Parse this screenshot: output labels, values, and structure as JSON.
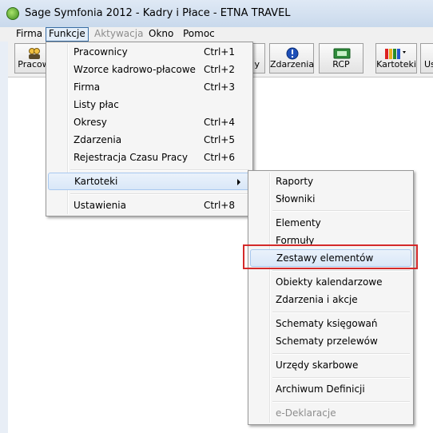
{
  "window": {
    "title": "Sage Symfonia 2012 - Kadry i Płace - ETNA TRAVEL"
  },
  "menubar": {
    "items": [
      {
        "label": "Firma",
        "state": "normal"
      },
      {
        "label": "Funkcje",
        "state": "active"
      },
      {
        "label": "Aktywacja",
        "state": "disabled"
      },
      {
        "label": "Okno",
        "state": "normal"
      },
      {
        "label": "Pomoc",
        "state": "normal"
      }
    ]
  },
  "toolbar": {
    "buttons": [
      {
        "label": "Pracow",
        "icon": "users-icon"
      },
      {
        "label": "y",
        "icon": ""
      },
      {
        "label": "Zdarzenia",
        "icon": "info-icon"
      },
      {
        "label": "RCP",
        "icon": "rcp-icon"
      },
      {
        "label": "Kartoteki",
        "icon": "kartoteki-icon"
      },
      {
        "label": "Us",
        "icon": ""
      }
    ]
  },
  "funkcje_menu": {
    "items": [
      {
        "label": "Pracownicy",
        "shortcut": "Ctrl+1"
      },
      {
        "label": "Wzorce kadrowo-płacowe",
        "shortcut": "Ctrl+2"
      },
      {
        "label": "Firma",
        "shortcut": "Ctrl+3"
      },
      {
        "label": "Listy płac",
        "shortcut": ""
      },
      {
        "label": "Okresy",
        "shortcut": "Ctrl+4"
      },
      {
        "label": "Zdarzenia",
        "shortcut": "Ctrl+5"
      },
      {
        "label": "Rejestracja Czasu Pracy",
        "shortcut": "Ctrl+6"
      },
      {
        "label": "Kartoteki",
        "shortcut": "",
        "submenu": true
      },
      {
        "label": "Ustawienia",
        "shortcut": "Ctrl+8"
      }
    ]
  },
  "kartoteki_menu": {
    "items": [
      {
        "label": "Raporty"
      },
      {
        "label": "Słowniki"
      },
      {
        "label": "Elementy"
      },
      {
        "label": "Formuły"
      },
      {
        "label": "Zestawy elementów",
        "highlighted": true
      },
      {
        "label": "Obiekty kalendarzowe"
      },
      {
        "label": "Zdarzenia i akcje"
      },
      {
        "label": "Schematy księgowań"
      },
      {
        "label": "Schematy przelewów"
      },
      {
        "label": "Urzędy skarbowe"
      },
      {
        "label": "Archiwum Definicji"
      },
      {
        "label": "e-Deklaracje",
        "disabled": true
      }
    ]
  },
  "colors": {
    "highlight_box": "#d42a2a",
    "menu_highlight": "#d9e7f8",
    "title_bar": "#c9d9ec"
  }
}
